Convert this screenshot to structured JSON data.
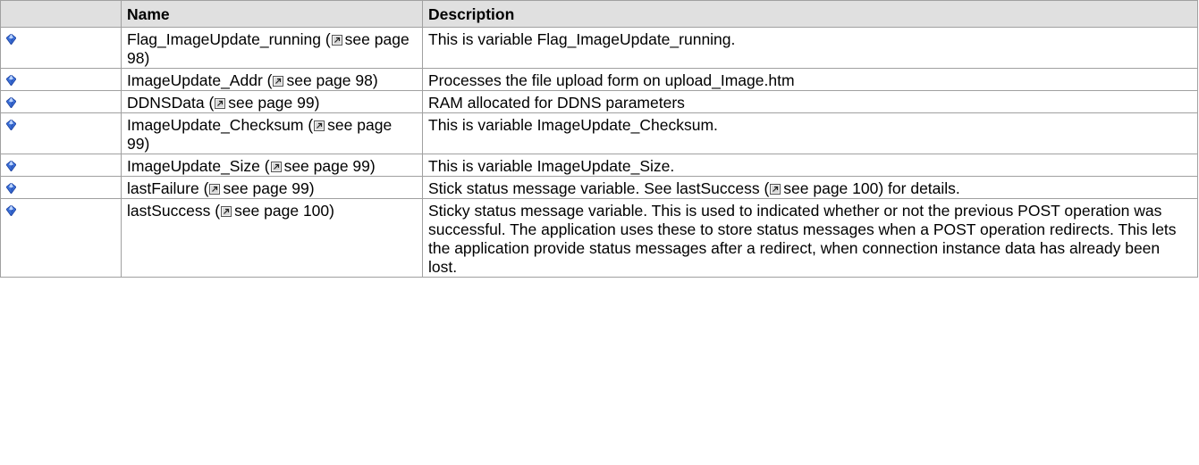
{
  "table": {
    "headers": [
      "",
      "Name",
      "Description"
    ],
    "rows": [
      {
        "icon": "blue-gem-icon",
        "name": "Flag_ImageUpdate_running",
        "page_ref": "see page 98",
        "desc_before": "This is variable Flag_ImageUpdate_running.",
        "desc_ref": "",
        "desc_after": ""
      },
      {
        "icon": "blue-gem-icon",
        "name": "ImageUpdate_Addr",
        "page_ref": "see page 98",
        "desc_before": "Processes the file upload form on upload_Image.htm",
        "desc_ref": "",
        "desc_after": ""
      },
      {
        "icon": "blue-gem-icon",
        "name": "DDNSData",
        "page_ref": "see page 99",
        "desc_before": "RAM allocated for DDNS parameters",
        "desc_ref": "",
        "desc_after": ""
      },
      {
        "icon": "blue-gem-icon",
        "name": "ImageUpdate_Checksum",
        "page_ref": "see page 99",
        "desc_before": "This is variable ImageUpdate_Checksum.",
        "desc_ref": "",
        "desc_after": ""
      },
      {
        "icon": "blue-gem-icon",
        "name": "ImageUpdate_Size",
        "page_ref": "see page 99",
        "desc_before": "This is variable ImageUpdate_Size.",
        "desc_ref": "",
        "desc_after": ""
      },
      {
        "icon": "blue-gem-icon",
        "name": "lastFailure",
        "page_ref": "see page 99",
        "desc_before": "Stick status message variable. See lastSuccess (",
        "desc_ref": "see page 100",
        "desc_after": ") for details."
      },
      {
        "icon": "blue-gem-icon",
        "name": "lastSuccess",
        "page_ref": "see page 100",
        "desc_before": "Sticky status message variable. This is used to indicated whether or not the previous POST operation was successful. The application uses these to store status messages when a POST operation redirects. This lets the application provide status messages after a redirect, when connection instance data has already been lost.",
        "desc_ref": "",
        "desc_after": ""
      }
    ]
  }
}
